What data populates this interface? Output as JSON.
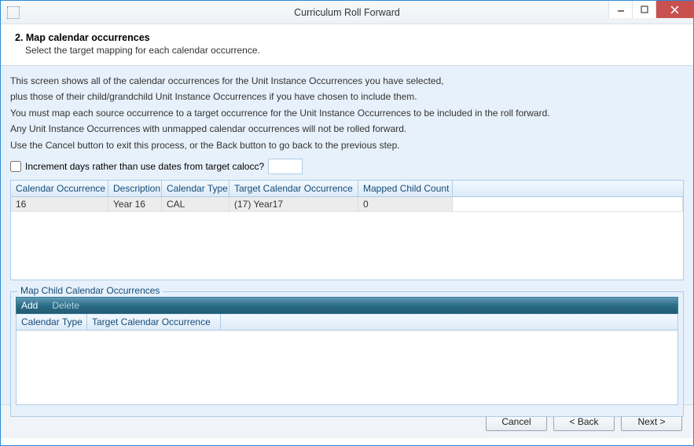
{
  "window": {
    "title": "Curriculum Roll Forward"
  },
  "header": {
    "step_title": "2. Map calendar occurrences",
    "step_sub": "Select the target mapping for each calendar occurrence."
  },
  "info": {
    "p1a": "This screen shows all of the calendar occurrences for the Unit Instance Occurrences you have selected,",
    "p1b": "plus those of their child/grandchild Unit Instance Occurrences if you have chosen to include them.",
    "p2a": "You must map each source occurrence to a target occurrence for the Unit Instance Occurrences to be included in the roll forward.",
    "p2b": "Any Unit Instance Occurrences with unmapped calendar occurrences will not be rolled forward.",
    "p3": "Use the Cancel button to exit this process, or the Back button to go back to the previous step."
  },
  "increment": {
    "label": "Increment days rather than use dates from target calocc?",
    "value": ""
  },
  "grid1": {
    "headers": [
      "Calendar Occurrence",
      "Description",
      "Calendar Type",
      "Target Calendar Occurrence",
      "Mapped Child Count"
    ],
    "rows": [
      {
        "occ": "16",
        "desc": "Year 16",
        "type": "CAL",
        "target": "(17) Year17",
        "count": "0"
      }
    ]
  },
  "child_section": {
    "legend": "Map Child Calendar Occurrences",
    "toolbar": {
      "add": "Add",
      "delete": "Delete"
    },
    "headers": [
      "Calendar Type",
      "Target Calendar Occurrence"
    ]
  },
  "footer": {
    "cancel": "Cancel",
    "back": "< Back",
    "next": "Next >"
  }
}
